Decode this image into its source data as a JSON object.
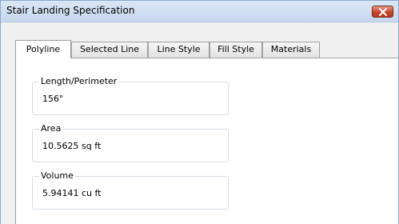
{
  "window": {
    "title": "Stair Landing Specification"
  },
  "tabs": [
    {
      "label": "Polyline",
      "active": true
    },
    {
      "label": "Selected Line",
      "active": false
    },
    {
      "label": "Line Style",
      "active": false
    },
    {
      "label": "Fill Style",
      "active": false
    },
    {
      "label": "Materials",
      "active": false
    }
  ],
  "fields": {
    "length": {
      "label": "Length/Perimeter",
      "value": "156\""
    },
    "area": {
      "label": "Area",
      "value": "10.5625 sq ft"
    },
    "volume": {
      "label": "Volume",
      "value": "5.94141 cu ft"
    }
  },
  "icons": {
    "close": "close-icon"
  },
  "colors": {
    "close_button": "#c8452c",
    "titlebar": "#d9e6f5"
  }
}
